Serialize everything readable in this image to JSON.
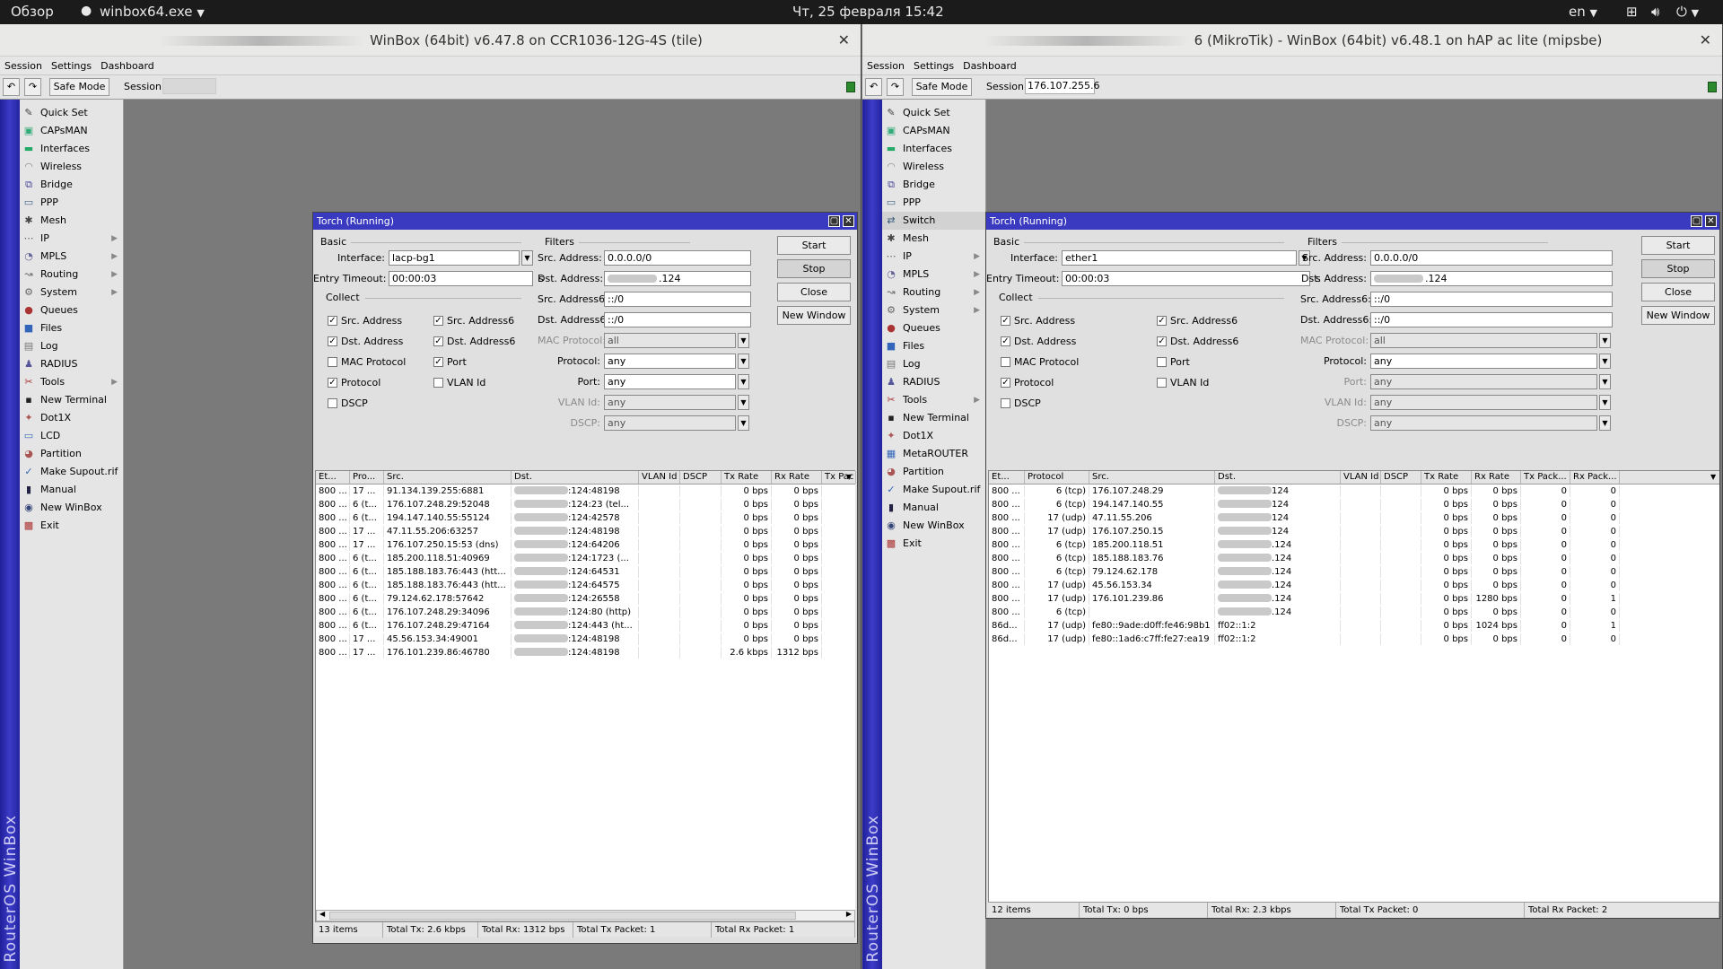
{
  "topbar": {
    "overview": "Обзор",
    "app": "winbox64.exe",
    "datetime": "Чт, 25 февраля  15:42",
    "lang": "en"
  },
  "left": {
    "title": "WinBox (64bit) v6.47.8 on CCR1036-12G-4S (tile)",
    "menu": [
      "Session",
      "Settings",
      "Dashboard"
    ],
    "safe_mode": "Safe Mode",
    "session_label": "Session:",
    "session_value": "",
    "brand": "RouterOS WinBox",
    "side": [
      "Quick Set",
      "CAPsMAN",
      "Interfaces",
      "Wireless",
      "Bridge",
      "PPP",
      "Mesh",
      "IP",
      "MPLS",
      "Routing",
      "System",
      "Queues",
      "Files",
      "Log",
      "RADIUS",
      "Tools",
      "New Terminal",
      "Dot1X",
      "LCD",
      "Partition",
      "Make Supout.rif",
      "Manual",
      "New WinBox",
      "Exit"
    ],
    "torch": {
      "title": "Torch (Running)",
      "basic": "Basic",
      "filters": "Filters",
      "collect": "Collect",
      "interface_label": "Interface:",
      "interface": "lacp-bg1",
      "timeout_label": "Entry Timeout:",
      "timeout": "00:00:03",
      "timeout_unit": "s",
      "src_label": "Src. Address:",
      "src": "0.0.0.0/0",
      "dst_label": "Dst. Address:",
      "dst_suffix": ".124",
      "src6_label": "Src. Address6:",
      "src6": "::/0",
      "dst6_label": "Dst. Address6:",
      "dst6": "::/0",
      "mac_label": "MAC Protocol:",
      "mac": "all",
      "proto_label": "Protocol:",
      "proto": "any",
      "port_label": "Port:",
      "port": "any",
      "vlan_label": "VLAN Id:",
      "vlan": "any",
      "dscp_label": "DSCP:",
      "dscp": "any",
      "cb": [
        "Src. Address",
        "Src. Address6",
        "Dst. Address",
        "Dst. Address6",
        "MAC Protocol",
        "Port",
        "Protocol",
        "VLAN Id",
        "DSCP"
      ],
      "buttons": [
        "Start",
        "Stop",
        "Close",
        "New Window"
      ],
      "cols": [
        "Et...",
        "Pro...",
        "Src.",
        "Dst.",
        "VLAN Id",
        "DSCP",
        "Tx Rate",
        "Rx Rate",
        "Tx Pac"
      ],
      "rows": [
        [
          "800 ...",
          "17 ...",
          "91.134.139.255:6881",
          ":124:48198",
          "",
          "",
          "0 bps",
          "0 bps"
        ],
        [
          "800 ...",
          "6 (t...",
          "176.107.248.29:52048",
          ":124:23 (tel...",
          "",
          "",
          "0 bps",
          "0 bps"
        ],
        [
          "800 ...",
          "6 (t...",
          "194.147.140.55:55124",
          ":124:42578",
          "",
          "",
          "0 bps",
          "0 bps"
        ],
        [
          "800 ...",
          "17 ...",
          "47.11.55.206:63257",
          ":124:48198",
          "",
          "",
          "0 bps",
          "0 bps"
        ],
        [
          "800 ...",
          "17 ...",
          "176.107.250.15:53 (dns)",
          ":124:64206",
          "",
          "",
          "0 bps",
          "0 bps"
        ],
        [
          "800 ...",
          "6 (t...",
          "185.200.118.51:40969",
          ":124:1723 (...",
          "",
          "",
          "0 bps",
          "0 bps"
        ],
        [
          "800 ...",
          "6 (t...",
          "185.188.183.76:443 (htt...",
          ":124:64531",
          "",
          "",
          "0 bps",
          "0 bps"
        ],
        [
          "800 ...",
          "6 (t...",
          "185.188.183.76:443 (htt...",
          ":124:64575",
          "",
          "",
          "0 bps",
          "0 bps"
        ],
        [
          "800 ...",
          "6 (t...",
          "79.124.62.178:57642",
          ":124:26558",
          "",
          "",
          "0 bps",
          "0 bps"
        ],
        [
          "800 ...",
          "6 (t...",
          "176.107.248.29:34096",
          ":124:80 (http)",
          "",
          "",
          "0 bps",
          "0 bps"
        ],
        [
          "800 ...",
          "6 (t...",
          "176.107.248.29:47164",
          ":124:443 (ht...",
          "",
          "",
          "0 bps",
          "0 bps"
        ],
        [
          "800 ...",
          "17 ...",
          "45.56.153.34:49001",
          ":124:48198",
          "",
          "",
          "0 bps",
          "0 bps"
        ],
        [
          "800 ...",
          "17 ...",
          "176.101.239.86:46780",
          ":124:48198",
          "",
          "",
          "2.6 kbps",
          "1312 bps"
        ]
      ],
      "status": [
        "13 items",
        "Total Tx: 2.6 kbps",
        "Total Rx: 1312 bps",
        "Total Tx Packet: 1",
        "Total Rx Packet: 1"
      ]
    }
  },
  "right": {
    "title": "6 (MikroTik) - WinBox (64bit) v6.48.1 on hAP ac lite (mipsbe)",
    "menu": [
      "Session",
      "Settings",
      "Dashboard"
    ],
    "safe_mode": "Safe Mode",
    "session_label": "Session:",
    "session_value": "176.107.255.6",
    "brand": "RouterOS WinBox",
    "side": [
      "Quick Set",
      "CAPsMAN",
      "Interfaces",
      "Wireless",
      "Bridge",
      "PPP",
      "Switch",
      "Mesh",
      "IP",
      "MPLS",
      "Routing",
      "System",
      "Queues",
      "Files",
      "Log",
      "RADIUS",
      "Tools",
      "New Terminal",
      "Dot1X",
      "MetaROUTER",
      "Partition",
      "Make Supout.rif",
      "Manual",
      "New WinBox",
      "Exit"
    ],
    "torch": {
      "title": "Torch (Running)",
      "basic": "Basic",
      "filters": "Filters",
      "collect": "Collect",
      "interface_label": "Interface:",
      "interface": "ether1",
      "timeout_label": "Entry Timeout:",
      "timeout": "00:00:03",
      "timeout_unit": "s",
      "src_label": "Src. Address:",
      "src": "0.0.0.0/0",
      "dst_label": "Dst. Address:",
      "dst_suffix": ".124",
      "src6_label": "Src. Address6:",
      "src6": "::/0",
      "dst6_label": "Dst. Address6:",
      "dst6": "::/0",
      "mac_label": "MAC Protocol:",
      "mac": "all",
      "proto_label": "Protocol:",
      "proto": "any",
      "port_label": "Port:",
      "port": "any",
      "vlan_label": "VLAN Id:",
      "vlan": "any",
      "dscp_label": "DSCP:",
      "dscp": "any",
      "cb": [
        "Src. Address",
        "Src. Address6",
        "Dst. Address",
        "Dst. Address6",
        "MAC Protocol",
        "Port",
        "Protocol",
        "VLAN Id",
        "DSCP"
      ],
      "buttons": [
        "Start",
        "Stop",
        "Close",
        "New Window"
      ],
      "cols": [
        "Et...",
        "Protocol",
        "Src.",
        "Dst.",
        "VLAN Id",
        "DSCP",
        "Tx Rate",
        "Rx Rate",
        "Tx Pack...",
        "Rx Pack..."
      ],
      "rows": [
        [
          "800 ...",
          "6 (tcp)",
          "176.107.248.29",
          "124",
          "",
          "",
          "0 bps",
          "0 bps",
          "0",
          "0"
        ],
        [
          "800 ...",
          "6 (tcp)",
          "194.147.140.55",
          "124",
          "",
          "",
          "0 bps",
          "0 bps",
          "0",
          "0"
        ],
        [
          "800 ...",
          "17 (udp)",
          "47.11.55.206",
          "124",
          "",
          "",
          "0 bps",
          "0 bps",
          "0",
          "0"
        ],
        [
          "800 ...",
          "17 (udp)",
          "176.107.250.15",
          "124",
          "",
          "",
          "0 bps",
          "0 bps",
          "0",
          "0"
        ],
        [
          "800 ...",
          "6 (tcp)",
          "185.200.118.51",
          ".124",
          "",
          "",
          "0 bps",
          "0 bps",
          "0",
          "0"
        ],
        [
          "800 ...",
          "6 (tcp)",
          "185.188.183.76",
          ".124",
          "",
          "",
          "0 bps",
          "0 bps",
          "0",
          "0"
        ],
        [
          "800 ...",
          "6 (tcp)",
          "79.124.62.178",
          ".124",
          "",
          "",
          "0 bps",
          "0 bps",
          "0",
          "0"
        ],
        [
          "800 ...",
          "17 (udp)",
          "45.56.153.34",
          ".124",
          "",
          "",
          "0 bps",
          "0 bps",
          "0",
          "0"
        ],
        [
          "800 ...",
          "17 (udp)",
          "176.101.239.86",
          ".124",
          "",
          "",
          "0 bps",
          "1280 bps",
          "0",
          "1"
        ],
        [
          "800 ...",
          "6 (tcp)",
          "",
          ".124",
          "",
          "",
          "0 bps",
          "0 bps",
          "0",
          "0"
        ],
        [
          "86d...",
          "17 (udp)",
          "fe80::9ade:d0ff:fe46:98b1",
          "ff02::1:2",
          "",
          "",
          "0 bps",
          "1024 bps",
          "0",
          "1"
        ],
        [
          "86d...",
          "17 (udp)",
          "fe80::1ad6:c7ff:fe27:ea19",
          "ff02::1:2",
          "",
          "",
          "0 bps",
          "0 bps",
          "0",
          "0"
        ]
      ],
      "status": [
        "12 items",
        "Total Tx: 0 bps",
        "Total Rx: 2.3 kbps",
        "Total Tx Packet: 0",
        "Total Rx Packet: 2"
      ]
    }
  }
}
